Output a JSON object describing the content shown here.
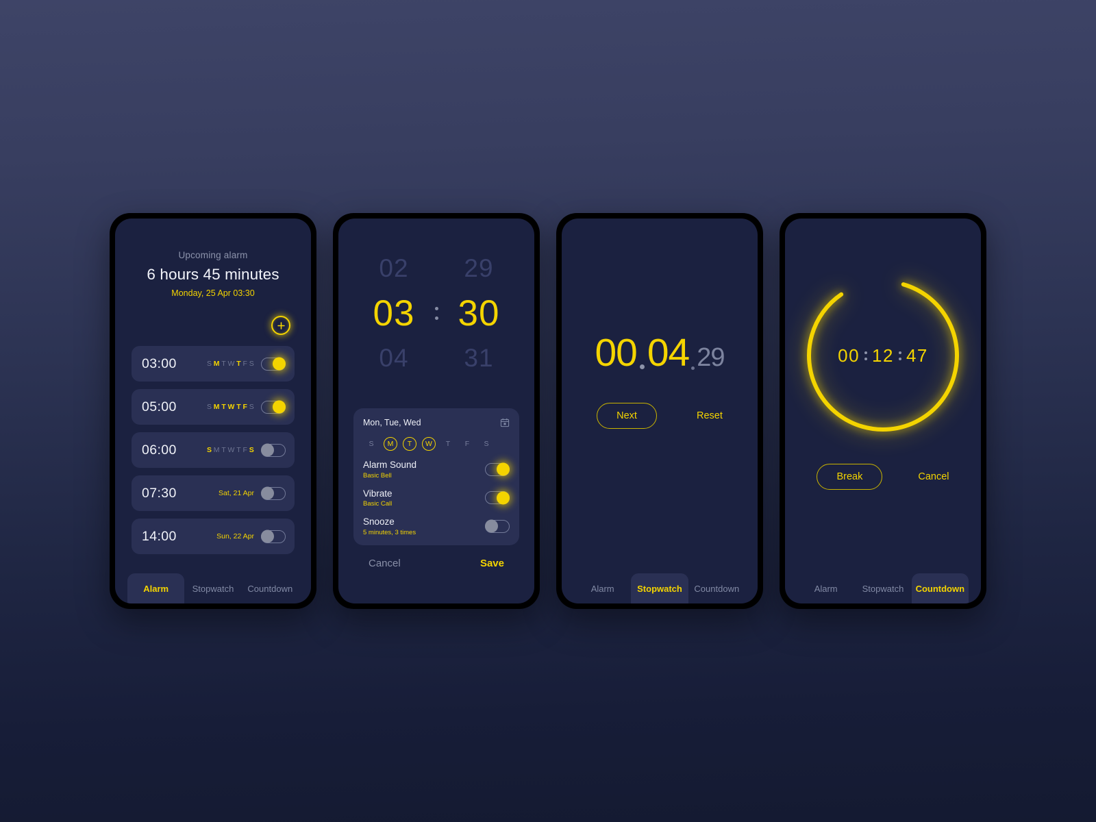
{
  "theme": {
    "accent": "#f4d400",
    "screen_bg": "#1b2140",
    "card_bg": "#2a3054",
    "bezel": "#000000",
    "muted_text": "#828aa5",
    "bright_text": "#f0f2f8"
  },
  "tabs": {
    "alarm": "Alarm",
    "stopwatch": "Stopwatch",
    "countdown": "Countdown"
  },
  "screen_alarm": {
    "upcoming_label": "Upcoming alarm",
    "duration": "6 hours 45 minutes",
    "date": "Monday, 25 Apr 03:30",
    "add_label": "+",
    "alarms": [
      {
        "time": "03:00",
        "mode": "days",
        "days": [
          "S",
          "M",
          "T",
          "W",
          "T",
          "F",
          "S"
        ],
        "active_days": [
          1,
          4
        ],
        "enabled": true
      },
      {
        "time": "05:00",
        "mode": "days",
        "days": [
          "S",
          "M",
          "T",
          "W",
          "T",
          "F",
          "S"
        ],
        "active_days": [
          1,
          2,
          3,
          4,
          5
        ],
        "enabled": true
      },
      {
        "time": "06:00",
        "mode": "days",
        "days": [
          "S",
          "M",
          "T",
          "W",
          "T",
          "F",
          "S"
        ],
        "active_days": [
          0,
          6
        ],
        "enabled": false
      },
      {
        "time": "07:30",
        "mode": "date",
        "date_label": "Sat, 21 Apr",
        "enabled": false
      },
      {
        "time": "14:00",
        "mode": "date",
        "date_label": "Sun, 22 Apr",
        "enabled": false
      }
    ]
  },
  "screen_edit": {
    "picker": {
      "hour_prev": "02",
      "hour": "03",
      "hour_next": "04",
      "minute_prev": "29",
      "minute": "30",
      "minute_next": "31"
    },
    "panel": {
      "repeat_summary": "Mon, Tue, Wed",
      "calendar_icon": "calendar-icon",
      "days": [
        "S",
        "M",
        "T",
        "W",
        "T",
        "F",
        "S"
      ],
      "selected_days": [
        1,
        2,
        3
      ],
      "settings": [
        {
          "name": "Alarm Sound",
          "sub": "Basic Bell",
          "enabled": true
        },
        {
          "name": "Vibrate",
          "sub": "Basic Call",
          "enabled": true
        },
        {
          "name": "Snooze",
          "sub": "5 minutes, 3 times",
          "enabled": false
        }
      ]
    },
    "cancel_label": "Cancel",
    "save_label": "Save"
  },
  "screen_stopwatch": {
    "main": "00.04",
    "minutes": "00",
    "seconds": "04",
    "millis": "29",
    "next_label": "Next",
    "reset_label": "Reset"
  },
  "screen_countdown": {
    "hours": "00",
    "minutes": "12",
    "seconds": "47",
    "progress_percent": 86,
    "break_label": "Break",
    "cancel_label": "Cancel"
  }
}
